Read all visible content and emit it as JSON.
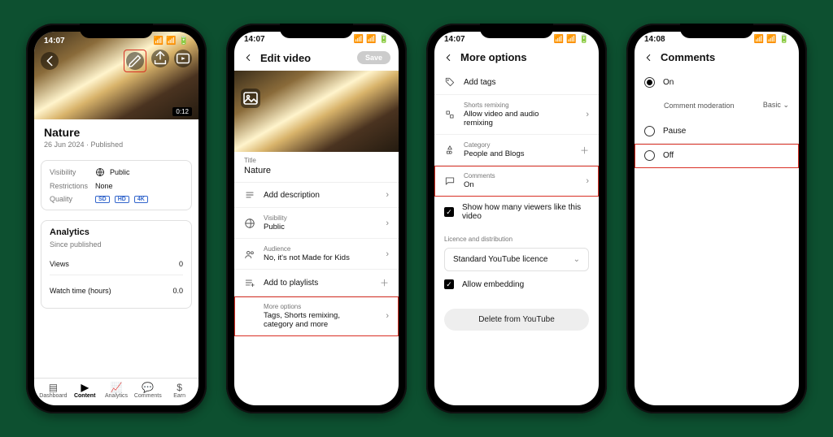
{
  "status": {
    "time": "14:07",
    "time_alt": "14:08"
  },
  "phone1": {
    "duration": "0:12",
    "title": "Nature",
    "date": "26 Jun 2024",
    "status": "Published",
    "info": {
      "visibility_label": "Visibility",
      "visibility_value": "Public",
      "restrictions_label": "Restrictions",
      "restrictions_value": "None",
      "quality_label": "Quality",
      "chips": [
        "SD",
        "HD",
        "4K"
      ]
    },
    "analytics": {
      "heading": "Analytics",
      "since": "Since published",
      "rows": [
        {
          "label": "Views",
          "value": "0"
        },
        {
          "label": "Watch time (hours)",
          "value": "0.0"
        }
      ]
    },
    "tabs": [
      "Dashboard",
      "Content",
      "Analytics",
      "Comments",
      "Earn"
    ]
  },
  "phone2": {
    "header": "Edit video",
    "save": "Save",
    "title_label": "Title",
    "title_value": "Nature",
    "rows": {
      "add_description": "Add description",
      "visibility_label": "Visibility",
      "visibility_value": "Public",
      "audience_label": "Audience",
      "audience_value": "No, it's not Made for Kids",
      "add_playlist": "Add to playlists",
      "more_label": "More options",
      "more_value": "Tags, Shorts remixing, category and more"
    }
  },
  "phone3": {
    "header": "More options",
    "rows": {
      "add_tags": "Add tags",
      "shorts_label": "Shorts remixing",
      "shorts_value": "Allow video and audio remixing",
      "category_label": "Category",
      "category_value": "People and Blogs",
      "comments_label": "Comments",
      "comments_value": "On",
      "show_likes": "Show how many viewers like this video"
    },
    "licence_heading": "Licence and distribution",
    "licence_value": "Standard YouTube licence",
    "allow_embedding": "Allow embedding",
    "delete": "Delete from YouTube"
  },
  "phone4": {
    "header": "Comments",
    "options": {
      "on": "On",
      "pause": "Pause",
      "off": "Off"
    },
    "moderation_label": "Comment moderation",
    "moderation_value": "Basic"
  }
}
